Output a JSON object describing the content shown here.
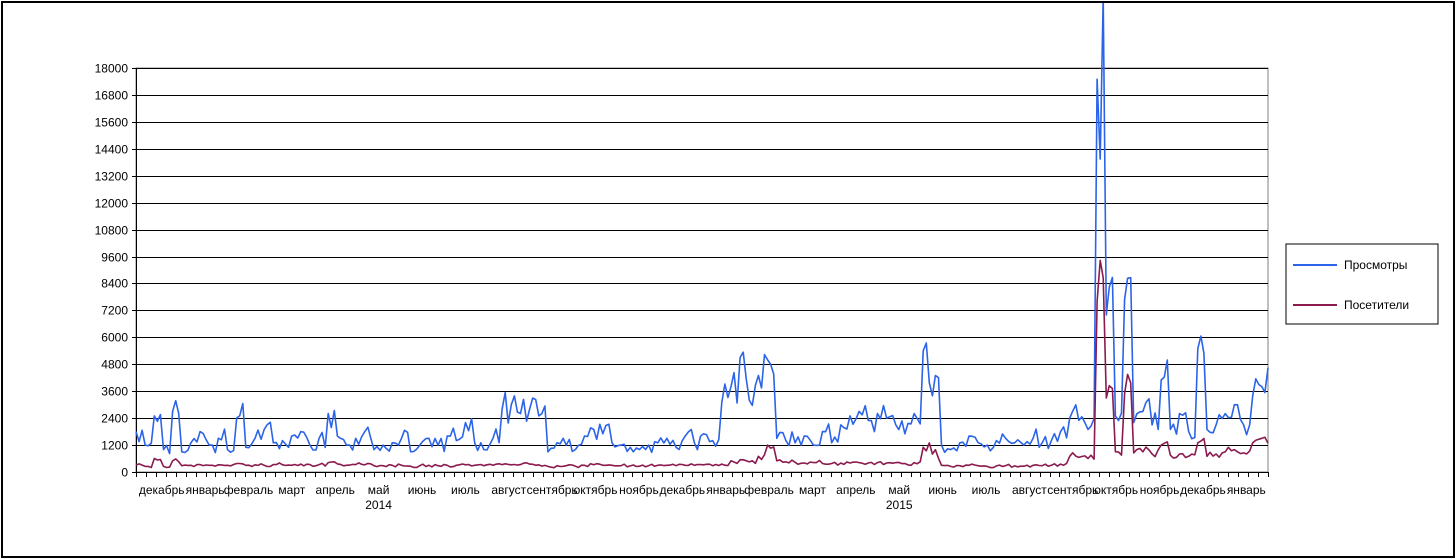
{
  "chart_data": {
    "type": "line",
    "title": "",
    "xlabel": "",
    "ylabel": "",
    "ylim": [
      0,
      18000
    ],
    "yticks": [
      0,
      1200,
      2400,
      3600,
      4800,
      6000,
      7200,
      8400,
      9600,
      10800,
      12000,
      13200,
      14400,
      15600,
      16800,
      18000
    ],
    "grid": true,
    "legend_position": "right",
    "x_months": [
      "декабрь",
      "январь",
      "февраль",
      "март",
      "апрель",
      "май",
      "июнь",
      "июль",
      "август",
      "сентябрь",
      "октябрь",
      "ноябрь",
      "декабрь",
      "январь",
      "февраль",
      "март",
      "апрель",
      "май",
      "июнь",
      "июль",
      "август",
      "сентябрь",
      "октябрь",
      "ноябрь",
      "декабрь",
      "январь"
    ],
    "x_years": [
      {
        "label": "2014",
        "month_index": 5
      },
      {
        "label": "2015",
        "month_index": 17
      }
    ],
    "x_weeks": [
      0,
      1,
      2,
      3,
      4,
      5,
      6,
      7,
      8,
      9,
      10,
      11,
      12,
      13,
      14,
      15,
      16,
      17,
      18,
      19,
      20,
      21,
      22,
      23,
      24,
      25,
      26,
      27,
      28,
      29,
      30,
      31,
      32,
      33,
      34,
      35,
      36,
      37,
      38,
      39,
      40,
      41,
      42,
      43,
      44,
      45,
      46,
      47,
      48,
      49,
      50,
      51,
      52,
      53,
      54,
      55,
      56,
      57,
      58,
      59,
      60,
      61,
      62,
      63,
      64,
      65,
      66,
      67,
      68,
      69,
      70,
      71,
      72,
      73,
      74,
      75,
      76,
      77,
      78,
      79,
      80,
      81,
      82,
      83,
      84,
      85,
      86,
      87,
      88,
      89,
      90,
      91,
      92,
      93,
      94,
      95,
      96,
      97,
      98,
      99,
      100,
      101,
      102,
      103,
      104,
      105,
      106,
      107,
      108,
      109,
      110,
      111,
      112,
      113
    ],
    "series": [
      {
        "name": "Просмотры",
        "color": "#2b64e8",
        "values": [
          1800,
          1200,
          2500,
          1000,
          2700,
          900,
          1300,
          1800,
          1200,
          1500,
          1000,
          2400,
          1100,
          1500,
          1900,
          1300,
          1400,
          1600,
          1800,
          1200,
          1500,
          2600,
          1600,
          1200,
          1500,
          1800,
          1000,
          1200,
          1300,
          1500,
          900,
          1200,
          1500,
          1200,
          1600,
          1400,
          2200,
          1300,
          1000,
          1500,
          2800,
          3000,
          2600,
          2800,
          2500,
          900,
          1300,
          1200,
          1000,
          1600,
          1900,
          1700,
          1300,
          1200,
          1100,
          1000,
          1200,
          1300,
          1500,
          1100,
          1600,
          1300,
          1700,
          1400,
          3100,
          3800,
          5100,
          3200,
          4300,
          5000,
          1500,
          1400,
          1300,
          1600,
          1200,
          1800,
          1300,
          2100,
          2500,
          2700,
          2300,
          2600,
          2400,
          2100,
          1700,
          2600,
          5400,
          3400,
          1200,
          1000,
          1300,
          1600,
          1300,
          1200,
          1400,
          1500,
          1300,
          1200,
          1500,
          1300,
          1400,
          1800,
          2400,
          2300,
          1900,
          17500,
          7000,
          2500,
          7700,
          2200,
          2700,
          2100,
          4100,
          1900,
          2600,
          1800,
          5500,
          1900,
          2100,
          2600,
          3000,
          2100,
          3400,
          3800
        ],
        "values_note": ""
      },
      {
        "name": "Посетители",
        "color": "#8b1a4e",
        "values": [
          300,
          250,
          600,
          250,
          500,
          280,
          300,
          330,
          300,
          320,
          300,
          380,
          300,
          320,
          300,
          330,
          320,
          300,
          350,
          330,
          330,
          420,
          360,
          300,
          330,
          320,
          280,
          280,
          300,
          300,
          260,
          280,
          300,
          280,
          300,
          300,
          320,
          300,
          280,
          300,
          330,
          320,
          330,
          350,
          320,
          250,
          280,
          280,
          260,
          300,
          320,
          300,
          300,
          280,
          270,
          260,
          280,
          300,
          300,
          280,
          300,
          300,
          320,
          280,
          350,
          500,
          550,
          450,
          700,
          1200,
          500,
          450,
          430,
          400,
          420,
          380,
          380,
          400,
          400,
          420,
          400,
          420,
          400,
          420,
          380,
          420,
          1100,
          800,
          300,
          250,
          280,
          300,
          280,
          250,
          270,
          280,
          270,
          260,
          300,
          280,
          300,
          350,
          700,
          650,
          600,
          7600,
          3300,
          900,
          3500,
          850,
          900,
          800,
          1200,
          750,
          800,
          700,
          1300,
          700,
          800,
          900,
          1000,
          850,
          1300,
          1500
        ]
      }
    ]
  },
  "legend": {
    "items": [
      {
        "label": "Просмотры",
        "color": "#2b64e8"
      },
      {
        "label": "Посетители",
        "color": "#8b1a4e"
      }
    ]
  }
}
